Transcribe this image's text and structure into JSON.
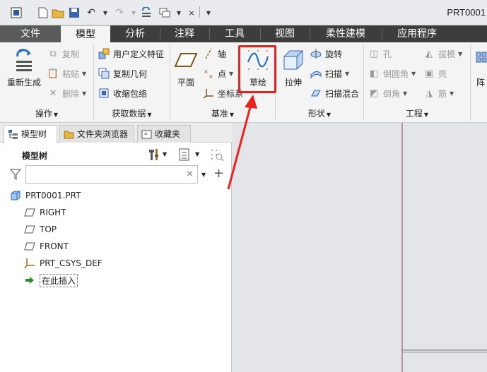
{
  "app": {
    "title": "PRT0001"
  },
  "tabs": [
    {
      "label": "文件"
    },
    {
      "label": "模型"
    },
    {
      "label": "分析"
    },
    {
      "label": "注释"
    },
    {
      "label": "工具"
    },
    {
      "label": "视图"
    },
    {
      "label": "柔性建模"
    },
    {
      "label": "应用程序"
    }
  ],
  "ribbon": {
    "operations": {
      "regenerate_label": "重新生成",
      "copy_label": "复制",
      "paste_label": "粘贴",
      "delete_label": "删除",
      "group_label": "操作"
    },
    "get_data": {
      "udf_label": "用户定义特征",
      "copy_geometry_label": "复制几何",
      "shrinkwrap_label": "收缩包络",
      "group_label": "获取数据"
    },
    "datum": {
      "plane_label": "平面",
      "axis_label": "轴",
      "point_label": "点",
      "csys_label": "坐标系",
      "sketch_label": "草绘",
      "group_label": "基准"
    },
    "shapes": {
      "extrude_label": "拉伸",
      "revolve_label": "旋转",
      "sweep_label": "扫描",
      "swept_blend_label": "扫描混合",
      "group_label": "形状"
    },
    "engineering": {
      "hole_label": "孔",
      "round_label": "倒圆角",
      "chamfer_label": "倒角",
      "draft_label": "拔模",
      "shell_label": "壳",
      "rib_label": "筋",
      "group_label": "工程"
    },
    "overflow_label": "阵"
  },
  "panel": {
    "tabs": [
      {
        "label": "模型树"
      },
      {
        "label": "文件夹浏览器"
      },
      {
        "label": "收藏夹"
      }
    ],
    "tree_title": "模型树",
    "filter_value": "",
    "tree": [
      {
        "label": "PRT0001.PRT",
        "icon": "part-icon"
      },
      {
        "label": "RIGHT",
        "icon": "datum-plane-icon"
      },
      {
        "label": "TOP",
        "icon": "datum-plane-icon"
      },
      {
        "label": "FRONT",
        "icon": "datum-plane-icon"
      },
      {
        "label": "PRT_CSYS_DEF",
        "icon": "csys-icon"
      },
      {
        "label": "在此插入",
        "icon": "insert-arrow-icon"
      }
    ]
  },
  "colors": {
    "tab_bar": "#3d3d3d",
    "accent_red": "#e8231f",
    "insert_arrow": "#2e8b2e"
  }
}
